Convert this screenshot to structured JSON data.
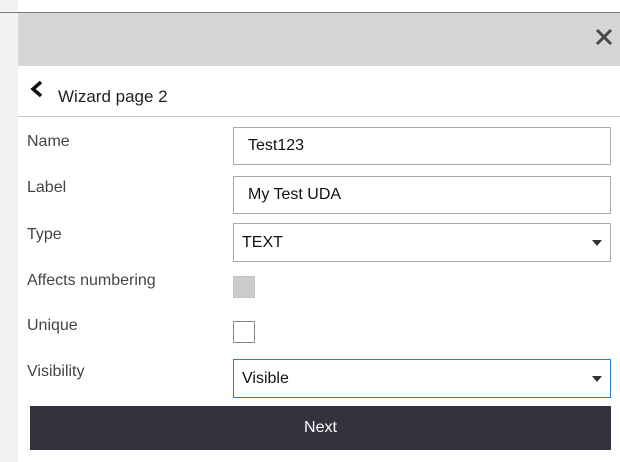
{
  "window": {
    "close_icon": "close-icon"
  },
  "header": {
    "back_icon": "chevron-left-icon",
    "title": "Wizard page 2"
  },
  "form": {
    "name": {
      "label": "Name",
      "value": "Test123"
    },
    "label_field": {
      "label": "Label",
      "value": "My Test UDA"
    },
    "type": {
      "label": "Type",
      "value": "TEXT"
    },
    "affects_numbering": {
      "label": "Affects numbering",
      "checked": false,
      "disabled": true
    },
    "unique": {
      "label": "Unique",
      "checked": false
    },
    "visibility": {
      "label": "Visibility",
      "value": "Visible"
    }
  },
  "actions": {
    "next_label": "Next"
  },
  "colors": {
    "titlebar": "#d6d6d6",
    "button": "#33323f",
    "focus": "#2b7bd1"
  }
}
